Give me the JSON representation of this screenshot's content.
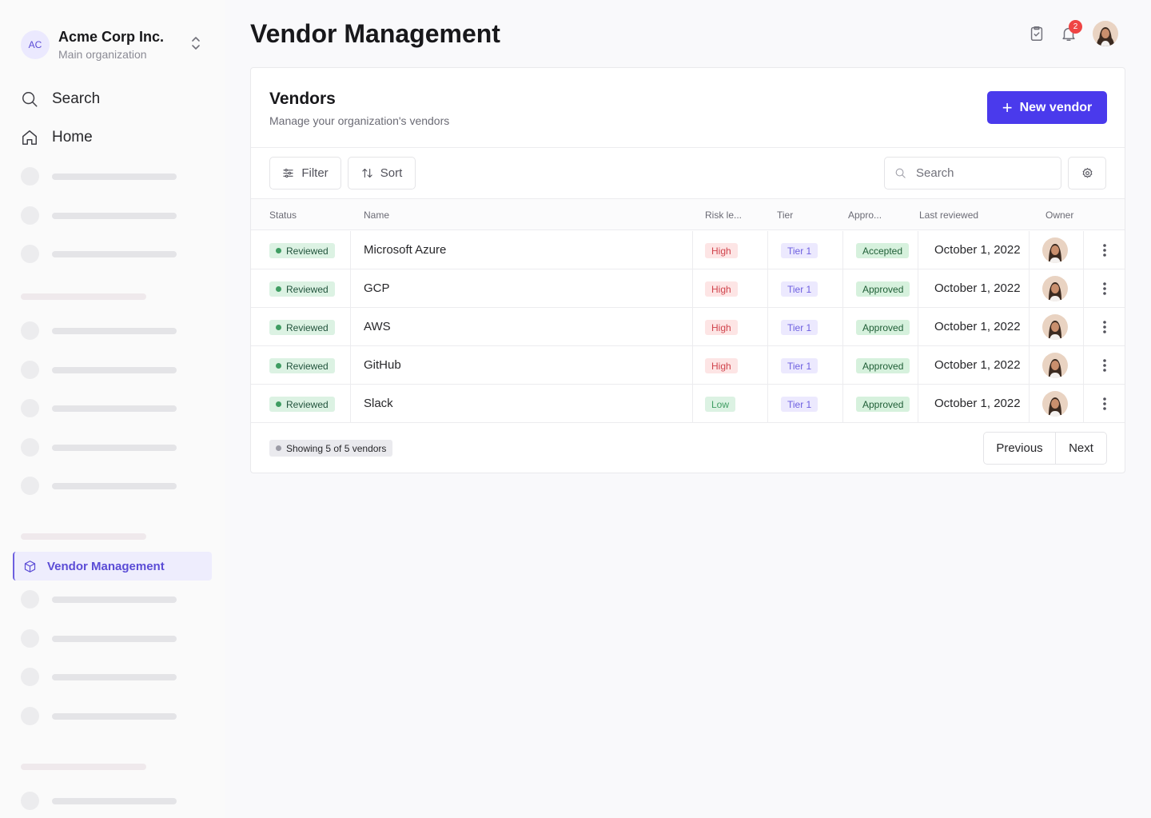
{
  "sidebar": {
    "org": {
      "initials": "AC",
      "name": "Acme Corp Inc.",
      "subtitle": "Main organization"
    },
    "nav": {
      "search": "Search",
      "home": "Home"
    },
    "active_item": "Vendor Management"
  },
  "header": {
    "title": "Vendor Management",
    "notification_count": "2"
  },
  "card": {
    "title": "Vendors",
    "subtitle": "Manage your organization's vendors",
    "new_button": "New vendor",
    "toolbar": {
      "filter": "Filter",
      "sort": "Sort",
      "search_placeholder": "Search"
    }
  },
  "table": {
    "columns": [
      "Status",
      "Name",
      "Risk le...",
      "Tier",
      "Appro...",
      "Last reviewed",
      "Owner"
    ],
    "rows": [
      {
        "status": "Reviewed",
        "name": "Microsoft Azure",
        "risk": "High",
        "tier": "Tier 1",
        "approval": "Accepted",
        "last_reviewed": "October 1, 2022"
      },
      {
        "status": "Reviewed",
        "name": "GCP",
        "risk": "High",
        "tier": "Tier 1",
        "approval": "Approved",
        "last_reviewed": "October 1, 2022"
      },
      {
        "status": "Reviewed",
        "name": "AWS",
        "risk": "High",
        "tier": "Tier 1",
        "approval": "Approved",
        "last_reviewed": "October 1, 2022"
      },
      {
        "status": "Reviewed",
        "name": "GitHub",
        "risk": "High",
        "tier": "Tier 1",
        "approval": "Approved",
        "last_reviewed": "October 1, 2022"
      },
      {
        "status": "Reviewed",
        "name": "Slack",
        "risk": "Low",
        "tier": "Tier 1",
        "approval": "Approved",
        "last_reviewed": "October 1, 2022"
      }
    ]
  },
  "footer": {
    "summary": "Showing 5 of 5 vendors",
    "previous": "Previous",
    "next": "Next"
  },
  "colors": {
    "primary": "#4a3aec",
    "active_nav": "#5b4cd6",
    "risk_high": "#d0444d",
    "risk_low": "#3f9d62",
    "notification": "#ef4444"
  }
}
